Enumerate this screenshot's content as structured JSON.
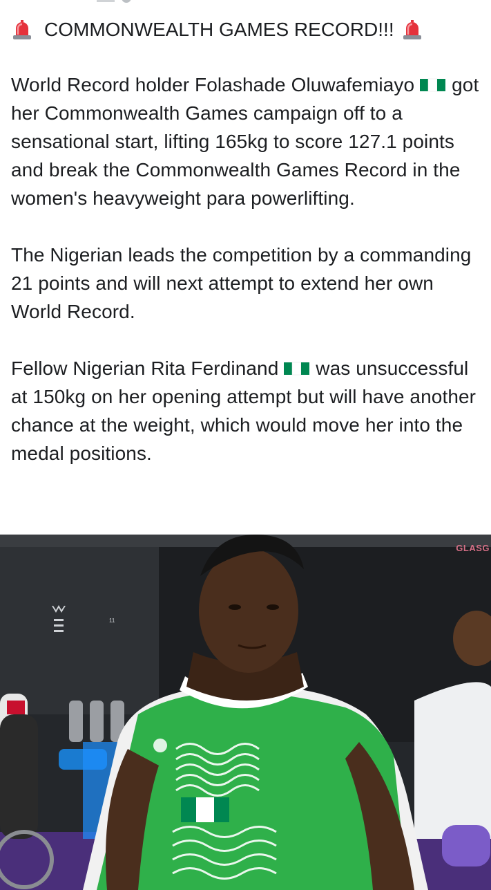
{
  "post": {
    "headline": "COMMONWEALTH GAMES RECORD!!!",
    "icons": {
      "siren": "police-car-light-emoji",
      "flag": "nigeria-flag-emoji"
    },
    "paragraph1": {
      "part1": "World Record holder Folashade Oluwafemiayo",
      "part2": "got her Commonwealth Games campaign off to a sensational start, lifting 165kg to score 127.1 points and break the Commonwealth Games Record in the women's heavyweight para powerlifting."
    },
    "paragraph2": "The Nigerian leads the competition by a commanding 21 points and will next attempt to extend her own World Record.",
    "paragraph3": {
      "part1": "Fellow Nigerian Rita Ferdinand",
      "part2": "was unsuccessful at 150kg on her opening attempt but will have another chance at the weight, which would move her into the medal positions."
    },
    "photo": {
      "sign_text": "GLASG",
      "colors": {
        "jersey_green": "#2fb04a",
        "flag_green": "#008751",
        "sign_pink": "#d56f86"
      }
    }
  }
}
